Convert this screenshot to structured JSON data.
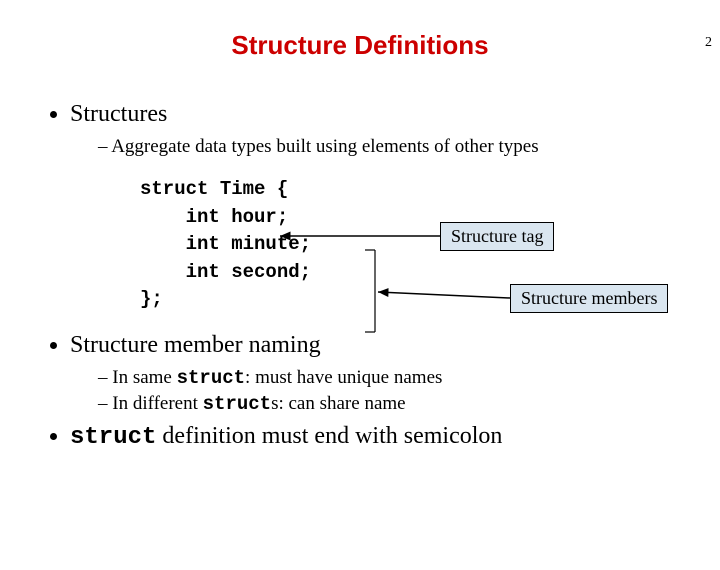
{
  "page_number": "2",
  "title": "Structure Definitions",
  "bullets": {
    "structures": "Structures",
    "aggregate": "Aggregate data types built using elements of other types",
    "naming": "Structure member naming",
    "naming_same_pre": "In same ",
    "naming_same_code": "struct",
    "naming_same_post": ": must have unique names",
    "naming_diff_pre": "In different ",
    "naming_diff_code": "struct",
    "naming_diff_post": "s: can share name",
    "semicolon_code": "struct",
    "semicolon_post": " definition must end with semicolon"
  },
  "code": {
    "l1": "struct Time {",
    "l2": "    int hour;",
    "l3": "    int minute;",
    "l4": "    int second;",
    "l5": "};"
  },
  "annotations": {
    "tag": "Structure tag",
    "members": "Structure members"
  }
}
